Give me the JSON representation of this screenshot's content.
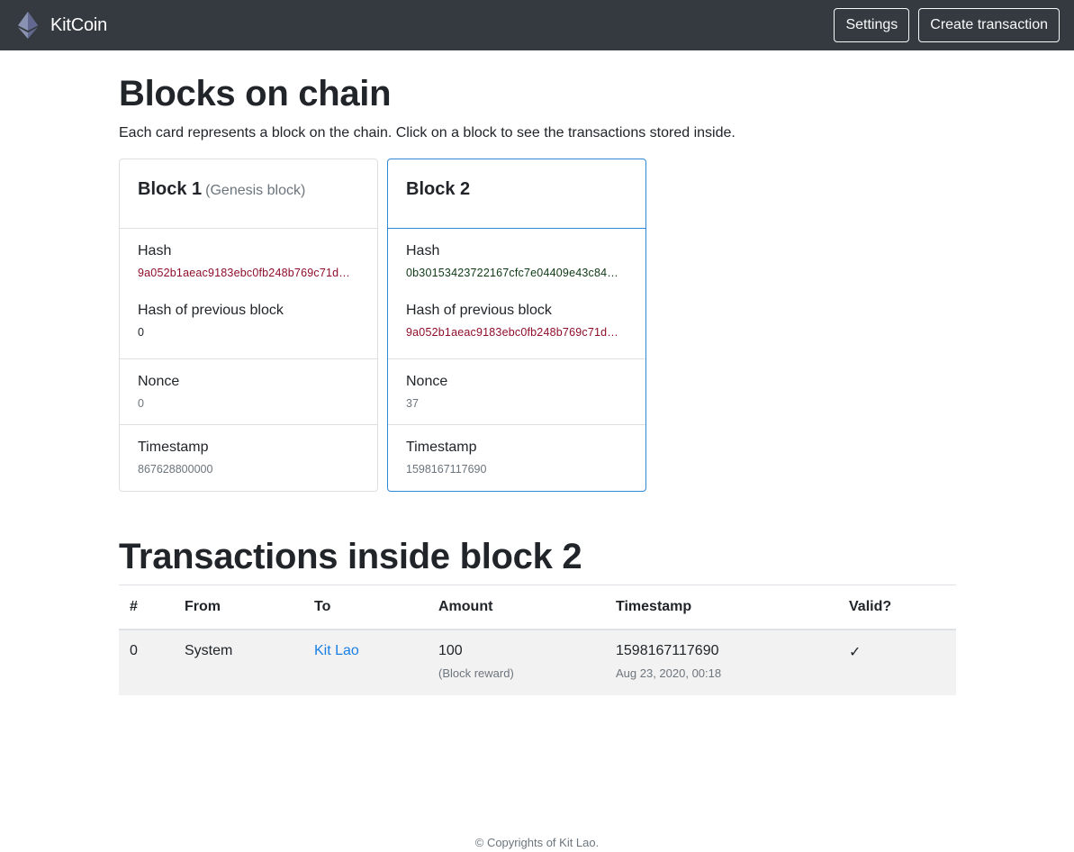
{
  "navbar": {
    "brand": "KitCoin",
    "logo_icon": "ethereum-diamond-icon",
    "settings_label": "Settings",
    "create_label": "Create transaction"
  },
  "page": {
    "title": "Blocks on chain",
    "lead": "Each card represents a block on the chain. Click on a block to see the transactions stored inside."
  },
  "blocks": [
    {
      "title": "Block 1",
      "subtitle": "(Genesis block)",
      "hash_label": "Hash",
      "hash": "9a052b1aeac9183ebc0fb248b769c71d…",
      "prev_label": "Hash of previous block",
      "prev_hash": "0",
      "nonce_label": "Nonce",
      "nonce": "0",
      "timestamp_label": "Timestamp",
      "timestamp": "867628800000"
    },
    {
      "title": "Block 2",
      "subtitle": "",
      "hash_label": "Hash",
      "hash": "0b30153423722167cfc7e04409e43c84…",
      "prev_label": "Hash of previous block",
      "prev_hash": "9a052b1aeac9183ebc0fb248b769c71d…",
      "nonce_label": "Nonce",
      "nonce": "37",
      "timestamp_label": "Timestamp",
      "timestamp": "1598167117690"
    }
  ],
  "transactions": {
    "title": "Transactions inside block 2",
    "headers": [
      "#",
      "From",
      "To",
      "Amount",
      "Timestamp",
      "Valid?"
    ],
    "rows": [
      {
        "num": "0",
        "from": "System",
        "to": "Kit Lao",
        "amount": "100",
        "amount_note": "(Block reward)",
        "timestamp": "1598167117690",
        "timestamp_human": "Aug 23, 2020, 00:18",
        "valid": "✓"
      }
    ]
  },
  "footer": {
    "text": "© Copyrights of Kit Lao."
  },
  "colors": {
    "navbar_bg": "#343a40",
    "selected_border": "#2f88d6",
    "hash_red": "#8e0e2b",
    "hash_green": "#0d3a14",
    "link": "#1a7fe4"
  }
}
